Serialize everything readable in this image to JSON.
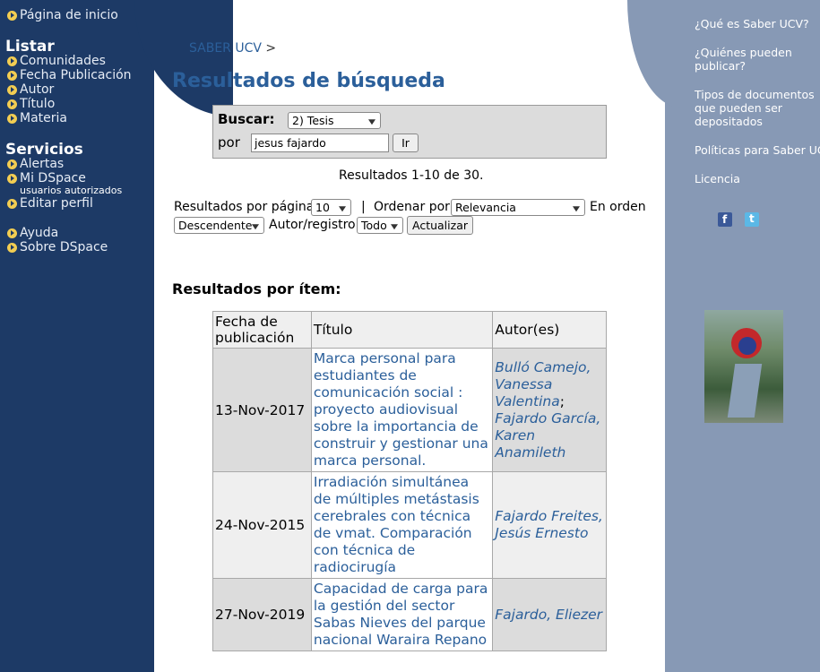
{
  "left_nav": {
    "home": "Página de inicio",
    "browse_heading": "Listar",
    "browse_items": [
      "Comunidades",
      "Fecha Publicación",
      "Autor",
      "Título",
      "Materia"
    ],
    "services_heading": "Servicios",
    "services_items": [
      {
        "label": "Alertas"
      },
      {
        "label": "Mi DSpace",
        "sub": "usuarios autorizados"
      },
      {
        "label": "Editar perfil"
      }
    ],
    "help_items": [
      "Ayuda",
      "Sobre DSpace"
    ]
  },
  "right_nav": {
    "links": [
      "¿Qué es Saber UCV?",
      "¿Quiénes pueden publicar?",
      "Tipos de documentos que pueden ser depositados",
      "Políticas para Saber UCV",
      "Licencia"
    ],
    "social": [
      "facebook-icon",
      "twitter-icon"
    ]
  },
  "breadcrumb": {
    "root": "SABER UCV",
    "sep": ">"
  },
  "page_title": "Resultados de búsqueda",
  "search": {
    "buscar_label": "Buscar:",
    "scope_value": "2) Tesis",
    "por_label": "por",
    "query": "jesus fajardo",
    "go_button": "Ir"
  },
  "result_count": "Resultados 1-10 de 30.",
  "controls": {
    "per_page_label": "Resultados por página",
    "per_page_value": "10",
    "pipe": "|",
    "sort_label": "Ordenar por",
    "sort_value": "Relevancia",
    "order_label": "En orden",
    "order_value": "Descendente",
    "author_label": "Autor/registro",
    "author_value": "Todo",
    "update_button": "Actualizar"
  },
  "section_title": "Resultados por ítem:",
  "table": {
    "headers": [
      "Fecha de publicación",
      "Título",
      "Autor(es)"
    ],
    "rows": [
      {
        "date": "13-Nov-2017",
        "title": "Marca personal para estudiantes de comunicación social : proyecto audiovisual sobre la importancia de construir y gestionar una marca personal.",
        "authors": [
          "Bulló Camejo, Vanessa Valentina",
          "Fajardo García, Karen Anamileth"
        ]
      },
      {
        "date": "24-Nov-2015",
        "title": "Irradiación simultánea de múltiples metástasis cerebrales con técnica de vmat. Comparación con técnica de radiocirugía",
        "authors": [
          "Fajardo Freites, Jesús Ernesto"
        ]
      },
      {
        "date": "27-Nov-2019",
        "title": "Capacidad de carga para la gestión del sector Sabas Nieves del parque nacional Waraira Repano",
        "authors": [
          "Fajardo, Eliezer"
        ]
      }
    ]
  },
  "colors": {
    "left_bg": "#1d3a66",
    "right_bg": "#8799b5",
    "link": "#2b5f9a"
  }
}
